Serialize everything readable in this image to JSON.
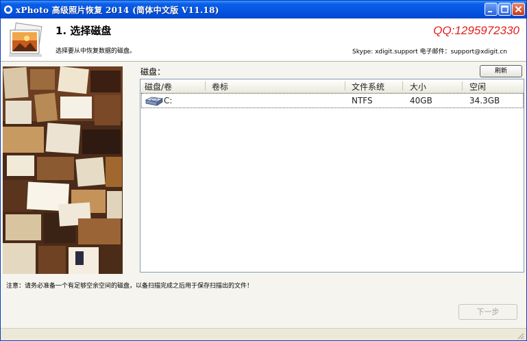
{
  "window": {
    "title": "xPhoto 高级照片恢复 2014 (简体中文版 V11.18)"
  },
  "header": {
    "step_title": "1. 选择磁盘",
    "step_subtitle": "选择要从中恢复数据的磁盘。",
    "qq": "QQ:1295972330",
    "contact": "Skype: xdigit.support  电子邮件：support@xdigit.cn"
  },
  "disk_panel": {
    "label": "磁盘：",
    "refresh_label": "刷新",
    "columns": [
      "磁盘/卷",
      "卷标",
      "文件系统",
      "大小",
      "空闲"
    ],
    "rows": [
      {
        "volume": "C:",
        "label": "",
        "filesystem": "NTFS",
        "size": "40GB",
        "free": "34.3GB"
      }
    ]
  },
  "note": "注意：请务必准备一个有足够空余空间的磁盘，以备扫描完成之后用于保存扫描出的文件！",
  "next_label": "下一步",
  "colors": {
    "titlebar": "#0454e0",
    "qq_text": "#e01f1f",
    "window_bg": "#ece9d8"
  },
  "icons": [
    "app-icon",
    "minimize-icon",
    "maximize-icon",
    "close-icon",
    "photo-stack-icon",
    "hard-drive-icon",
    "resize-grip-icon"
  ]
}
